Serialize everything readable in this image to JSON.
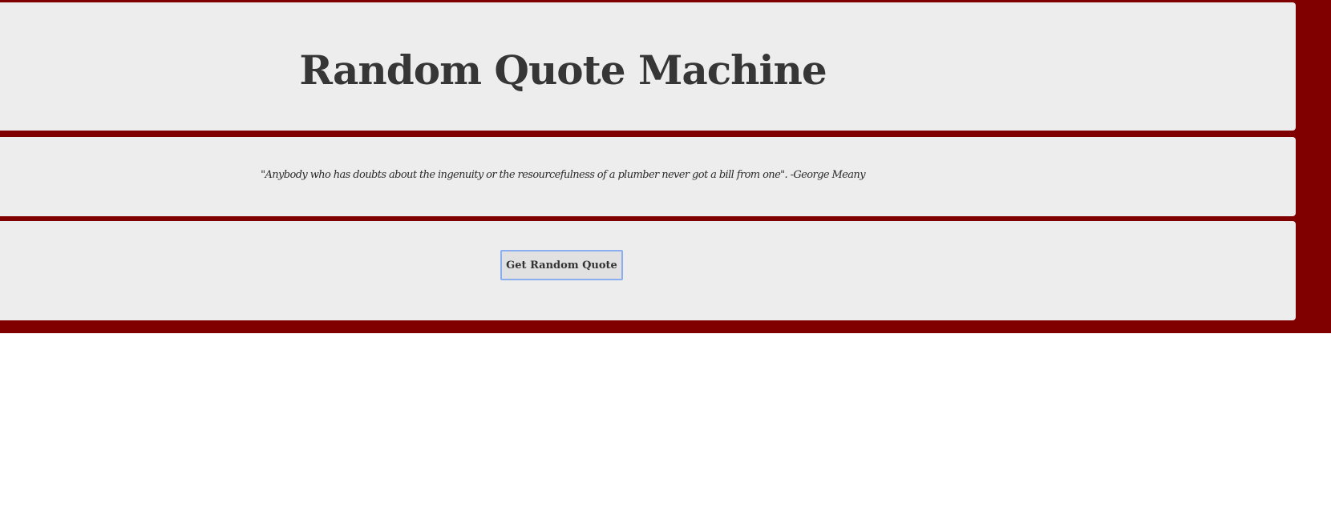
{
  "header": {
    "title": "Random Quote Machine"
  },
  "quote": {
    "text": "\"Anybody who has doubts about the ingenuity or the resourcefulness of a plumber never got a bill from one\". -George Meany"
  },
  "actions": {
    "random_quote_label": "Get Random Quote"
  },
  "colors": {
    "background": "#800000",
    "panel": "#eeedee",
    "text": "#363636",
    "button_border": "#8aaef0"
  }
}
